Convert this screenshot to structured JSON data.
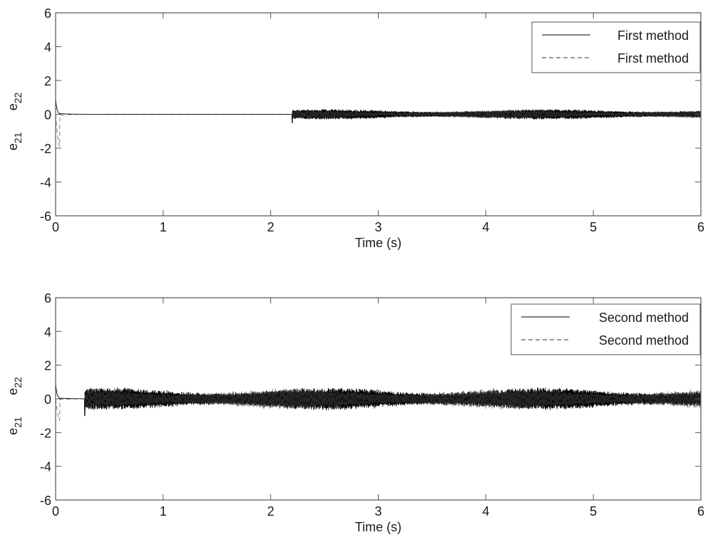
{
  "chart_data": [
    {
      "type": "line",
      "title": "",
      "xlabel": "Time (s)",
      "ylabel_top": "e22",
      "ylabel_bottom": "e21",
      "ylabel_top_base": "e",
      "ylabel_top_sub": "22",
      "ylabel_bottom_base": "e",
      "ylabel_bottom_sub": "21",
      "xlim": [
        0,
        6
      ],
      "ylim": [
        -6,
        6
      ],
      "xticks": [
        "0",
        "1",
        "2",
        "3",
        "4",
        "5",
        "6"
      ],
      "yticks": [
        "-6",
        "-4",
        "-2",
        "0",
        "2",
        "4",
        "6"
      ],
      "grid": false,
      "legend_position": "top-right",
      "series": [
        {
          "name": "First method",
          "style": "solid",
          "color": "#000000",
          "transient_peak": 0.9,
          "steady_until": 2.2,
          "chatter_start": 2.2,
          "chatter_amplitude": 0.3,
          "dip_at_chatter_start": -0.5
        },
        {
          "name": "First method",
          "style": "dashed",
          "color": "#333333",
          "transient_min": -1.9,
          "steady_until": 2.2,
          "chatter_start": 2.2,
          "chatter_amplitude": 0.25
        }
      ]
    },
    {
      "type": "line",
      "title": "",
      "xlabel": "Time (s)",
      "ylabel_top_base": "e",
      "ylabel_top_sub": "22",
      "ylabel_bottom_base": "e",
      "ylabel_bottom_sub": "21",
      "xlim": [
        0,
        6
      ],
      "ylim": [
        -6,
        6
      ],
      "xticks": [
        "0",
        "1",
        "2",
        "3",
        "4",
        "5",
        "6"
      ],
      "yticks": [
        "-6",
        "-4",
        "-2",
        "0",
        "2",
        "4",
        "6"
      ],
      "grid": false,
      "legend_position": "top-right",
      "series": [
        {
          "name": "Second method",
          "style": "solid",
          "color": "#000000",
          "transient_peak": 0.9,
          "steady_until": 0.27,
          "chatter_start": 0.27,
          "chatter_amplitude": 0.65,
          "dip_at_chatter_start": -1.0
        },
        {
          "name": "Second method",
          "style": "dashed",
          "color": "#333333",
          "transient_min": -1.3,
          "steady_until": 0.27,
          "chatter_start": 0.27,
          "chatter_amplitude": 0.6
        }
      ]
    }
  ]
}
